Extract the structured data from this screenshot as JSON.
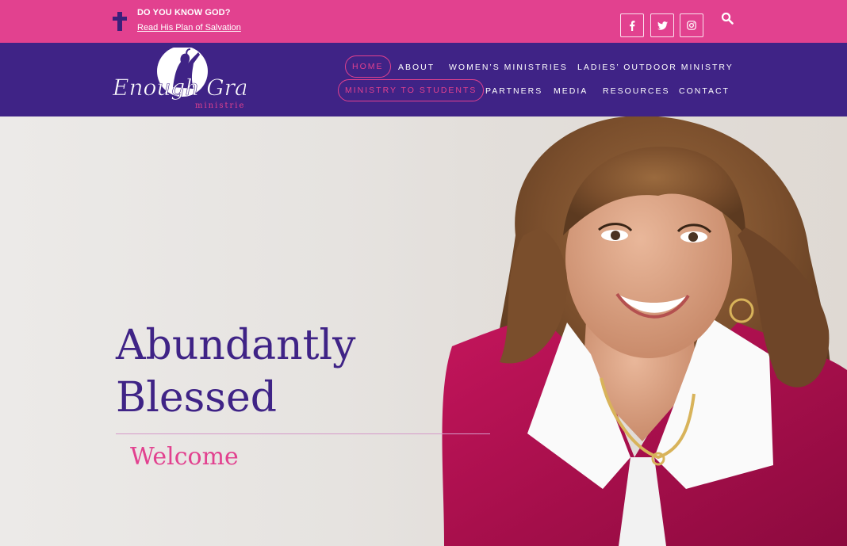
{
  "topbar": {
    "question": "DO YOU KNOW GOD?",
    "plan_link": "Read His Plan of Salvation",
    "social": [
      "facebook-icon",
      "twitter-icon",
      "instagram-icon"
    ],
    "colors": {
      "background": "#e2418f",
      "cross": "#3b1f7a"
    }
  },
  "logo": {
    "name": "Enough Grace",
    "tagline": "ministries"
  },
  "nav": {
    "items": [
      {
        "label": "HOME",
        "active": true
      },
      {
        "label": "ABOUT"
      },
      {
        "label": "WOMEN’S MINISTRIES"
      },
      {
        "label": "LADIES’ OUTDOOR MINISTRY"
      },
      {
        "label": "MINISTRY TO STUDENTS",
        "outlined": true
      },
      {
        "label": "PARTNERS"
      },
      {
        "label": "MEDIA"
      },
      {
        "label": "RESOURCES"
      },
      {
        "label": "CONTACT"
      }
    ],
    "colors": {
      "background": "#3f2386",
      "accent": "#e2418f"
    }
  },
  "hero": {
    "title_line1": "Abundantly",
    "title_line2": "Blessed",
    "subtitle": "Welcome",
    "colors": {
      "title": "#3f2386",
      "subtitle": "#e2418f"
    }
  }
}
